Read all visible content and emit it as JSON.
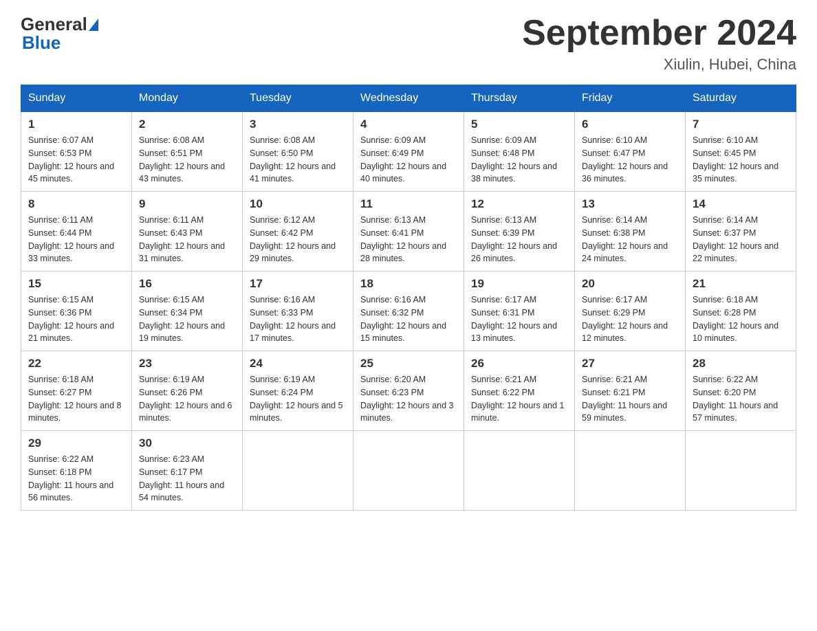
{
  "logo": {
    "general": "General",
    "blue": "Blue"
  },
  "header": {
    "title": "September 2024",
    "subtitle": "Xiulin, Hubei, China"
  },
  "days_of_week": [
    "Sunday",
    "Monday",
    "Tuesday",
    "Wednesday",
    "Thursday",
    "Friday",
    "Saturday"
  ],
  "weeks": [
    [
      {
        "day": 1,
        "sunrise": "6:07 AM",
        "sunset": "6:53 PM",
        "daylight": "12 hours and 45 minutes."
      },
      {
        "day": 2,
        "sunrise": "6:08 AM",
        "sunset": "6:51 PM",
        "daylight": "12 hours and 43 minutes."
      },
      {
        "day": 3,
        "sunrise": "6:08 AM",
        "sunset": "6:50 PM",
        "daylight": "12 hours and 41 minutes."
      },
      {
        "day": 4,
        "sunrise": "6:09 AM",
        "sunset": "6:49 PM",
        "daylight": "12 hours and 40 minutes."
      },
      {
        "day": 5,
        "sunrise": "6:09 AM",
        "sunset": "6:48 PM",
        "daylight": "12 hours and 38 minutes."
      },
      {
        "day": 6,
        "sunrise": "6:10 AM",
        "sunset": "6:47 PM",
        "daylight": "12 hours and 36 minutes."
      },
      {
        "day": 7,
        "sunrise": "6:10 AM",
        "sunset": "6:45 PM",
        "daylight": "12 hours and 35 minutes."
      }
    ],
    [
      {
        "day": 8,
        "sunrise": "6:11 AM",
        "sunset": "6:44 PM",
        "daylight": "12 hours and 33 minutes."
      },
      {
        "day": 9,
        "sunrise": "6:11 AM",
        "sunset": "6:43 PM",
        "daylight": "12 hours and 31 minutes."
      },
      {
        "day": 10,
        "sunrise": "6:12 AM",
        "sunset": "6:42 PM",
        "daylight": "12 hours and 29 minutes."
      },
      {
        "day": 11,
        "sunrise": "6:13 AM",
        "sunset": "6:41 PM",
        "daylight": "12 hours and 28 minutes."
      },
      {
        "day": 12,
        "sunrise": "6:13 AM",
        "sunset": "6:39 PM",
        "daylight": "12 hours and 26 minutes."
      },
      {
        "day": 13,
        "sunrise": "6:14 AM",
        "sunset": "6:38 PM",
        "daylight": "12 hours and 24 minutes."
      },
      {
        "day": 14,
        "sunrise": "6:14 AM",
        "sunset": "6:37 PM",
        "daylight": "12 hours and 22 minutes."
      }
    ],
    [
      {
        "day": 15,
        "sunrise": "6:15 AM",
        "sunset": "6:36 PM",
        "daylight": "12 hours and 21 minutes."
      },
      {
        "day": 16,
        "sunrise": "6:15 AM",
        "sunset": "6:34 PM",
        "daylight": "12 hours and 19 minutes."
      },
      {
        "day": 17,
        "sunrise": "6:16 AM",
        "sunset": "6:33 PM",
        "daylight": "12 hours and 17 minutes."
      },
      {
        "day": 18,
        "sunrise": "6:16 AM",
        "sunset": "6:32 PM",
        "daylight": "12 hours and 15 minutes."
      },
      {
        "day": 19,
        "sunrise": "6:17 AM",
        "sunset": "6:31 PM",
        "daylight": "12 hours and 13 minutes."
      },
      {
        "day": 20,
        "sunrise": "6:17 AM",
        "sunset": "6:29 PM",
        "daylight": "12 hours and 12 minutes."
      },
      {
        "day": 21,
        "sunrise": "6:18 AM",
        "sunset": "6:28 PM",
        "daylight": "12 hours and 10 minutes."
      }
    ],
    [
      {
        "day": 22,
        "sunrise": "6:18 AM",
        "sunset": "6:27 PM",
        "daylight": "12 hours and 8 minutes."
      },
      {
        "day": 23,
        "sunrise": "6:19 AM",
        "sunset": "6:26 PM",
        "daylight": "12 hours and 6 minutes."
      },
      {
        "day": 24,
        "sunrise": "6:19 AM",
        "sunset": "6:24 PM",
        "daylight": "12 hours and 5 minutes."
      },
      {
        "day": 25,
        "sunrise": "6:20 AM",
        "sunset": "6:23 PM",
        "daylight": "12 hours and 3 minutes."
      },
      {
        "day": 26,
        "sunrise": "6:21 AM",
        "sunset": "6:22 PM",
        "daylight": "12 hours and 1 minute."
      },
      {
        "day": 27,
        "sunrise": "6:21 AM",
        "sunset": "6:21 PM",
        "daylight": "11 hours and 59 minutes."
      },
      {
        "day": 28,
        "sunrise": "6:22 AM",
        "sunset": "6:20 PM",
        "daylight": "11 hours and 57 minutes."
      }
    ],
    [
      {
        "day": 29,
        "sunrise": "6:22 AM",
        "sunset": "6:18 PM",
        "daylight": "11 hours and 56 minutes."
      },
      {
        "day": 30,
        "sunrise": "6:23 AM",
        "sunset": "6:17 PM",
        "daylight": "11 hours and 54 minutes."
      },
      null,
      null,
      null,
      null,
      null
    ]
  ]
}
